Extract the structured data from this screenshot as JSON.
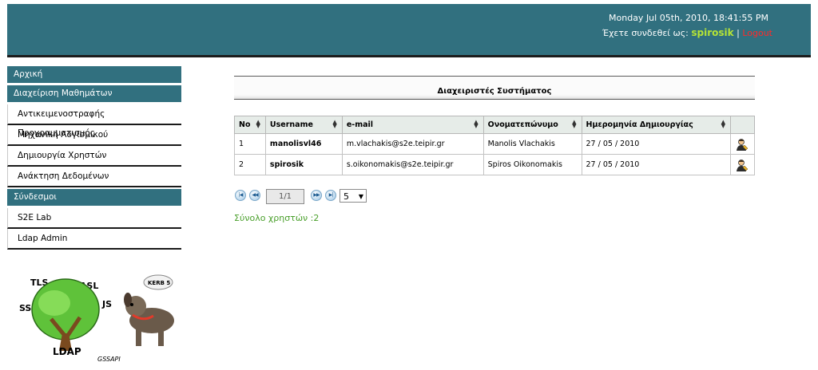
{
  "header": {
    "datetime": "Monday Jul 05th, 2010, 18:41:55 PM",
    "logged_in_label": "Έχετε συνδεθεί ως:",
    "username": "spirosik",
    "separator": "|",
    "logout": "Logout"
  },
  "sidebar": {
    "sections": [
      {
        "label": "Αρχική"
      },
      {
        "label": "Διαχείριση Μαθημάτων"
      }
    ],
    "course_items": [
      "Αντικειμενοστραφής Προγραμματισμός",
      "Μηχανική Λογισμικού",
      "Δημιουργία Χρηστών",
      "Ανάκτηση Δεδομένων"
    ],
    "links_section": "Σύνδεσμοι",
    "link_items": [
      "S2E Lab",
      "Ldap Admin"
    ],
    "logo_words": [
      "TLS",
      "SASL",
      "SSL",
      "JS",
      "LDAP",
      "GSSAPI",
      "KERB 5"
    ]
  },
  "main": {
    "title": "Διαχειριστές Συστήματος",
    "columns": [
      "No",
      "Username",
      "e-mail",
      "Ονοματεπώνυμο",
      "Ημερομηνία Δημιουργίας"
    ],
    "rows": [
      {
        "no": "1",
        "username": "manolisvl46",
        "email": "m.vlachakis@s2e.teipir.gr",
        "name": "Manolis Vlachakis",
        "date": "27 / 05 / 2010"
      },
      {
        "no": "2",
        "username": "spirosik",
        "email": "s.oikonomakis@s2e.teipir.gr",
        "name": "Spiros Oikonomakis",
        "date": "27 / 05 / 2010"
      }
    ],
    "pager": {
      "page": "1/1",
      "page_size": "5"
    },
    "total": "Σύνολο χρηστών :2"
  },
  "colors": {
    "header_bg": "#31707f",
    "accent_green": "#4aa02c",
    "logout_red": "#ff2a2a",
    "username_green": "#b5e436"
  }
}
